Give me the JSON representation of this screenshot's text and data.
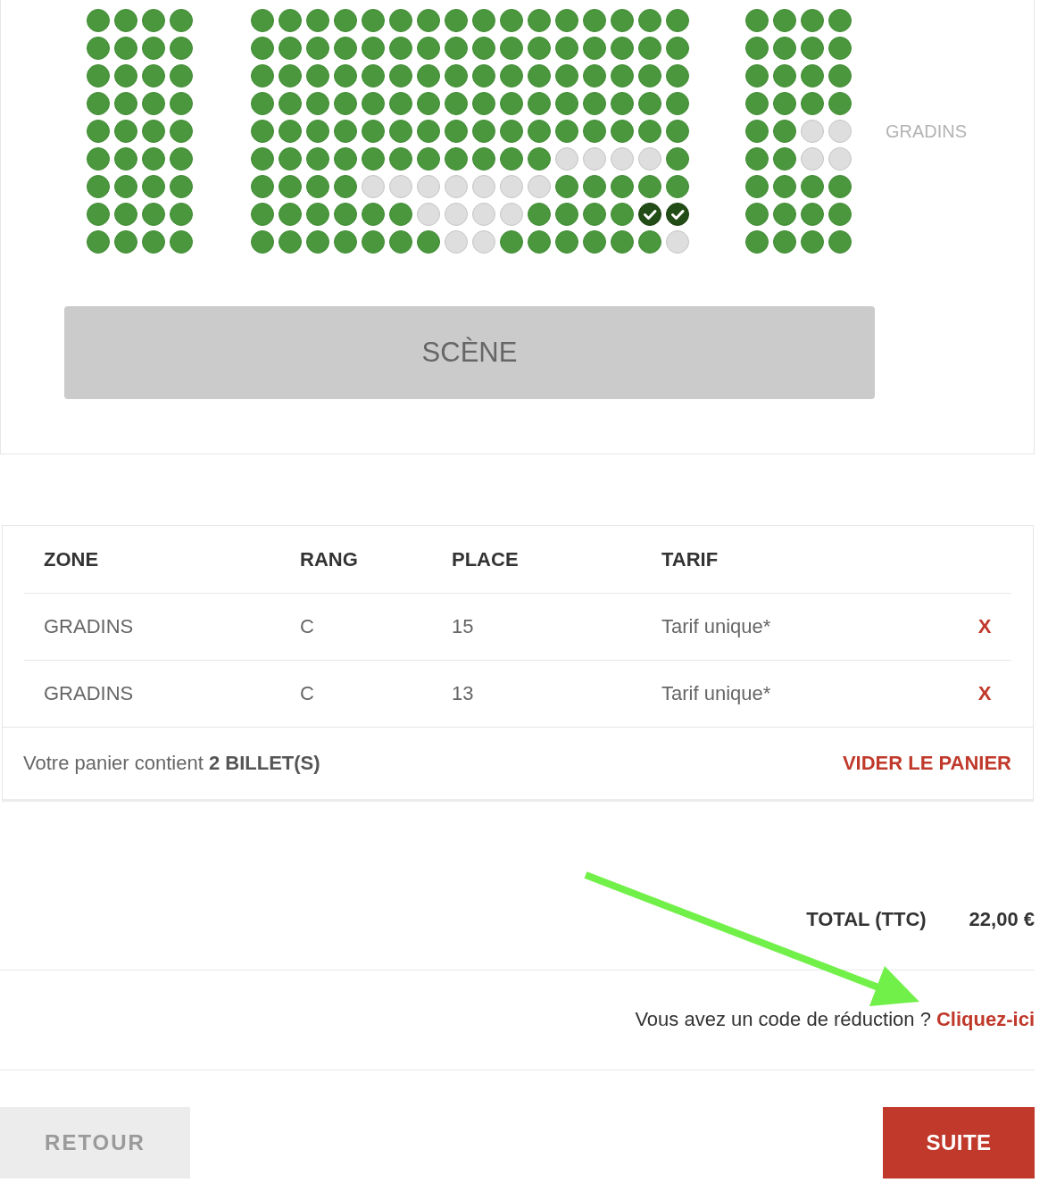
{
  "seat_map": {
    "blocks": [
      {
        "rows": [
          [
            {
              "available": true,
              "selected": false
            },
            {
              "available": true,
              "selected": false
            },
            {
              "available": true,
              "selected": false
            },
            {
              "available": true,
              "selected": false
            }
          ],
          [
            {
              "available": true,
              "selected": false
            },
            {
              "available": true,
              "selected": false
            },
            {
              "available": true,
              "selected": false
            },
            {
              "available": true,
              "selected": false
            }
          ],
          [
            {
              "available": true,
              "selected": false
            },
            {
              "available": true,
              "selected": false
            },
            {
              "available": true,
              "selected": false
            },
            {
              "available": true,
              "selected": false
            }
          ],
          [
            {
              "available": true,
              "selected": false
            },
            {
              "available": true,
              "selected": false
            },
            {
              "available": true,
              "selected": false
            },
            {
              "available": true,
              "selected": false
            }
          ],
          [
            {
              "available": true,
              "selected": false
            },
            {
              "available": true,
              "selected": false
            },
            {
              "available": true,
              "selected": false
            },
            {
              "available": true,
              "selected": false
            }
          ],
          [
            {
              "available": true,
              "selected": false
            },
            {
              "available": true,
              "selected": false
            },
            {
              "available": true,
              "selected": false
            },
            {
              "available": true,
              "selected": false
            }
          ],
          [
            {
              "available": true,
              "selected": false
            },
            {
              "available": true,
              "selected": false
            },
            {
              "available": true,
              "selected": false
            },
            {
              "available": true,
              "selected": false
            }
          ],
          [
            {
              "available": true,
              "selected": false
            },
            {
              "available": true,
              "selected": false
            },
            {
              "available": true,
              "selected": false
            },
            {
              "available": true,
              "selected": false
            }
          ],
          [
            {
              "available": true,
              "selected": false
            },
            {
              "available": true,
              "selected": false
            },
            {
              "available": true,
              "selected": false
            },
            {
              "available": true,
              "selected": false
            }
          ]
        ]
      },
      {
        "rows": [
          [
            {
              "available": true,
              "selected": false
            },
            {
              "available": true,
              "selected": false
            },
            {
              "available": true,
              "selected": false
            },
            {
              "available": true,
              "selected": false
            },
            {
              "available": true,
              "selected": false
            },
            {
              "available": true,
              "selected": false
            },
            {
              "available": true,
              "selected": false
            },
            {
              "available": true,
              "selected": false
            },
            {
              "available": true,
              "selected": false
            },
            {
              "available": true,
              "selected": false
            },
            {
              "available": true,
              "selected": false
            },
            {
              "available": true,
              "selected": false
            },
            {
              "available": true,
              "selected": false
            },
            {
              "available": true,
              "selected": false
            },
            {
              "available": true,
              "selected": false
            },
            {
              "available": true,
              "selected": false
            }
          ],
          [
            {
              "available": true,
              "selected": false
            },
            {
              "available": true,
              "selected": false
            },
            {
              "available": true,
              "selected": false
            },
            {
              "available": true,
              "selected": false
            },
            {
              "available": true,
              "selected": false
            },
            {
              "available": true,
              "selected": false
            },
            {
              "available": true,
              "selected": false
            },
            {
              "available": true,
              "selected": false
            },
            {
              "available": true,
              "selected": false
            },
            {
              "available": true,
              "selected": false
            },
            {
              "available": true,
              "selected": false
            },
            {
              "available": true,
              "selected": false
            },
            {
              "available": true,
              "selected": false
            },
            {
              "available": true,
              "selected": false
            },
            {
              "available": true,
              "selected": false
            },
            {
              "available": true,
              "selected": false
            }
          ],
          [
            {
              "available": true,
              "selected": false
            },
            {
              "available": true,
              "selected": false
            },
            {
              "available": true,
              "selected": false
            },
            {
              "available": true,
              "selected": false
            },
            {
              "available": true,
              "selected": false
            },
            {
              "available": true,
              "selected": false
            },
            {
              "available": true,
              "selected": false
            },
            {
              "available": true,
              "selected": false
            },
            {
              "available": true,
              "selected": false
            },
            {
              "available": true,
              "selected": false
            },
            {
              "available": true,
              "selected": false
            },
            {
              "available": true,
              "selected": false
            },
            {
              "available": true,
              "selected": false
            },
            {
              "available": true,
              "selected": false
            },
            {
              "available": true,
              "selected": false
            },
            {
              "available": true,
              "selected": false
            }
          ],
          [
            {
              "available": true,
              "selected": false
            },
            {
              "available": true,
              "selected": false
            },
            {
              "available": true,
              "selected": false
            },
            {
              "available": true,
              "selected": false
            },
            {
              "available": true,
              "selected": false
            },
            {
              "available": true,
              "selected": false
            },
            {
              "available": true,
              "selected": false
            },
            {
              "available": true,
              "selected": false
            },
            {
              "available": true,
              "selected": false
            },
            {
              "available": true,
              "selected": false
            },
            {
              "available": true,
              "selected": false
            },
            {
              "available": true,
              "selected": false
            },
            {
              "available": true,
              "selected": false
            },
            {
              "available": true,
              "selected": false
            },
            {
              "available": true,
              "selected": false
            },
            {
              "available": true,
              "selected": false
            }
          ],
          [
            {
              "available": true,
              "selected": false
            },
            {
              "available": true,
              "selected": false
            },
            {
              "available": true,
              "selected": false
            },
            {
              "available": true,
              "selected": false
            },
            {
              "available": true,
              "selected": false
            },
            {
              "available": true,
              "selected": false
            },
            {
              "available": true,
              "selected": false
            },
            {
              "available": true,
              "selected": false
            },
            {
              "available": true,
              "selected": false
            },
            {
              "available": true,
              "selected": false
            },
            {
              "available": true,
              "selected": false
            },
            {
              "available": true,
              "selected": false
            },
            {
              "available": true,
              "selected": false
            },
            {
              "available": true,
              "selected": false
            },
            {
              "available": true,
              "selected": false
            },
            {
              "available": true,
              "selected": false
            }
          ],
          [
            {
              "available": true,
              "selected": false
            },
            {
              "available": true,
              "selected": false
            },
            {
              "available": true,
              "selected": false
            },
            {
              "available": true,
              "selected": false
            },
            {
              "available": true,
              "selected": false
            },
            {
              "available": true,
              "selected": false
            },
            {
              "available": true,
              "selected": false
            },
            {
              "available": true,
              "selected": false
            },
            {
              "available": true,
              "selected": false
            },
            {
              "available": true,
              "selected": false
            },
            {
              "available": true,
              "selected": false
            },
            {
              "available": false,
              "selected": false
            },
            {
              "available": false,
              "selected": false
            },
            {
              "available": false,
              "selected": false
            },
            {
              "available": false,
              "selected": false
            },
            {
              "available": true,
              "selected": false
            }
          ],
          [
            {
              "available": true,
              "selected": false
            },
            {
              "available": true,
              "selected": false
            },
            {
              "available": true,
              "selected": false
            },
            {
              "available": true,
              "selected": false
            },
            {
              "available": false,
              "selected": false
            },
            {
              "available": false,
              "selected": false
            },
            {
              "available": false,
              "selected": false
            },
            {
              "available": false,
              "selected": false
            },
            {
              "available": false,
              "selected": false
            },
            {
              "available": false,
              "selected": false
            },
            {
              "available": false,
              "selected": false
            },
            {
              "available": true,
              "selected": false
            },
            {
              "available": true,
              "selected": false
            },
            {
              "available": true,
              "selected": false
            },
            {
              "available": true,
              "selected": false
            },
            {
              "available": true,
              "selected": false
            }
          ],
          [
            {
              "available": true,
              "selected": false
            },
            {
              "available": true,
              "selected": false
            },
            {
              "available": true,
              "selected": false
            },
            {
              "available": true,
              "selected": false
            },
            {
              "available": true,
              "selected": false
            },
            {
              "available": true,
              "selected": false
            },
            {
              "available": false,
              "selected": false
            },
            {
              "available": false,
              "selected": false
            },
            {
              "available": false,
              "selected": false
            },
            {
              "available": false,
              "selected": false
            },
            {
              "available": true,
              "selected": false
            },
            {
              "available": true,
              "selected": false
            },
            {
              "available": true,
              "selected": false
            },
            {
              "available": true,
              "selected": false
            },
            {
              "available": true,
              "selected": true
            },
            {
              "available": true,
              "selected": true
            }
          ],
          [
            {
              "available": true,
              "selected": false
            },
            {
              "available": true,
              "selected": false
            },
            {
              "available": true,
              "selected": false
            },
            {
              "available": true,
              "selected": false
            },
            {
              "available": true,
              "selected": false
            },
            {
              "available": true,
              "selected": false
            },
            {
              "available": true,
              "selected": false
            },
            {
              "available": false,
              "selected": false
            },
            {
              "available": false,
              "selected": false
            },
            {
              "available": true,
              "selected": false
            },
            {
              "available": true,
              "selected": false
            },
            {
              "available": true,
              "selected": false
            },
            {
              "available": true,
              "selected": false
            },
            {
              "available": true,
              "selected": false
            },
            {
              "available": true,
              "selected": false
            },
            {
              "available": false,
              "selected": false
            }
          ]
        ]
      },
      {
        "rows": [
          [
            {
              "available": true,
              "selected": false
            },
            {
              "available": true,
              "selected": false
            },
            {
              "available": true,
              "selected": false
            },
            {
              "available": true,
              "selected": false
            }
          ],
          [
            {
              "available": true,
              "selected": false
            },
            {
              "available": true,
              "selected": false
            },
            {
              "available": true,
              "selected": false
            },
            {
              "available": true,
              "selected": false
            }
          ],
          [
            {
              "available": true,
              "selected": false
            },
            {
              "available": true,
              "selected": false
            },
            {
              "available": true,
              "selected": false
            },
            {
              "available": true,
              "selected": false
            }
          ],
          [
            {
              "available": true,
              "selected": false
            },
            {
              "available": true,
              "selected": false
            },
            {
              "available": true,
              "selected": false
            },
            {
              "available": true,
              "selected": false
            }
          ],
          [
            {
              "available": true,
              "selected": false
            },
            {
              "available": true,
              "selected": false
            },
            {
              "available": false,
              "selected": false
            },
            {
              "available": false,
              "selected": false
            }
          ],
          [
            {
              "available": true,
              "selected": false
            },
            {
              "available": true,
              "selected": false
            },
            {
              "available": false,
              "selected": false
            },
            {
              "available": false,
              "selected": false
            }
          ],
          [
            {
              "available": true,
              "selected": false
            },
            {
              "available": true,
              "selected": false
            },
            {
              "available": true,
              "selected": false
            },
            {
              "available": true,
              "selected": false
            }
          ],
          [
            {
              "available": true,
              "selected": false
            },
            {
              "available": true,
              "selected": false
            },
            {
              "available": true,
              "selected": false
            },
            {
              "available": true,
              "selected": false
            }
          ],
          [
            {
              "available": true,
              "selected": false
            },
            {
              "available": true,
              "selected": false
            },
            {
              "available": true,
              "selected": false
            },
            {
              "available": true,
              "selected": false
            }
          ]
        ]
      }
    ],
    "zone_label": "GRADINS",
    "stage": "SCÈNE"
  },
  "cart": {
    "columns": [
      "ZONE",
      "RANG",
      "PLACE",
      "TARIF"
    ],
    "rows": [
      {
        "cells": [
          "GRADINS",
          "C",
          "15",
          "Tarif unique*"
        ],
        "remove": "X"
      },
      {
        "cells": [
          "GRADINS",
          "C",
          "13",
          "Tarif unique*"
        ],
        "remove": "X"
      }
    ],
    "summary": "Votre panier contient **2 BILLET(S)**",
    "clear_link": "VIDER LE PANIER"
  },
  "total": {
    "label": "TOTAL (TTC)",
    "amount": "22,00 €"
  },
  "discount": {
    "text": "Vous avez un code de réduction ?",
    "link": "Cliquez-ici"
  },
  "buttons": {
    "back": "RETOUR",
    "next": "SUITE"
  }
}
